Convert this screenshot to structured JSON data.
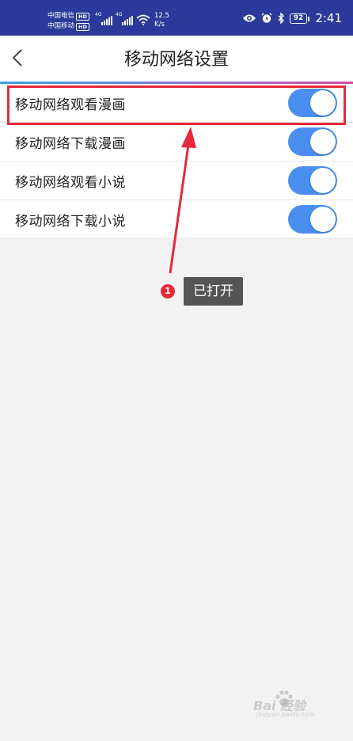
{
  "status_bar": {
    "carriers": [
      {
        "name": "中国电信",
        "badge": "HD"
      },
      {
        "name": "中国移动",
        "badge": "HD"
      }
    ],
    "network_type": "4G",
    "speed_value": "12.5",
    "speed_unit": "K/s",
    "battery": "92",
    "time": "2:41",
    "icons": [
      "signal-icon",
      "wifi-icon",
      "eye-icon",
      "alarm-icon",
      "bluetooth-icon",
      "battery-icon"
    ]
  },
  "header": {
    "back_icon": "chevron-left-icon",
    "title": "移动网络设置"
  },
  "settings": [
    {
      "label": "移动网络观看漫画",
      "enabled": true
    },
    {
      "label": "移动网络下载漫画",
      "enabled": true
    },
    {
      "label": "移动网络观看小说",
      "enabled": true
    },
    {
      "label": "移动网络下载小说",
      "enabled": true
    }
  ],
  "annotation": {
    "step": "1",
    "text": "已打开"
  },
  "watermark": {
    "text": "Bai 经验",
    "sub": "jingyan.baidu.com"
  },
  "colors": {
    "status_bar": "#2b3a9a",
    "toggle_on": "#4a8ff0",
    "annotation_red": "#e8283c",
    "tooltip_bg": "#555555"
  }
}
